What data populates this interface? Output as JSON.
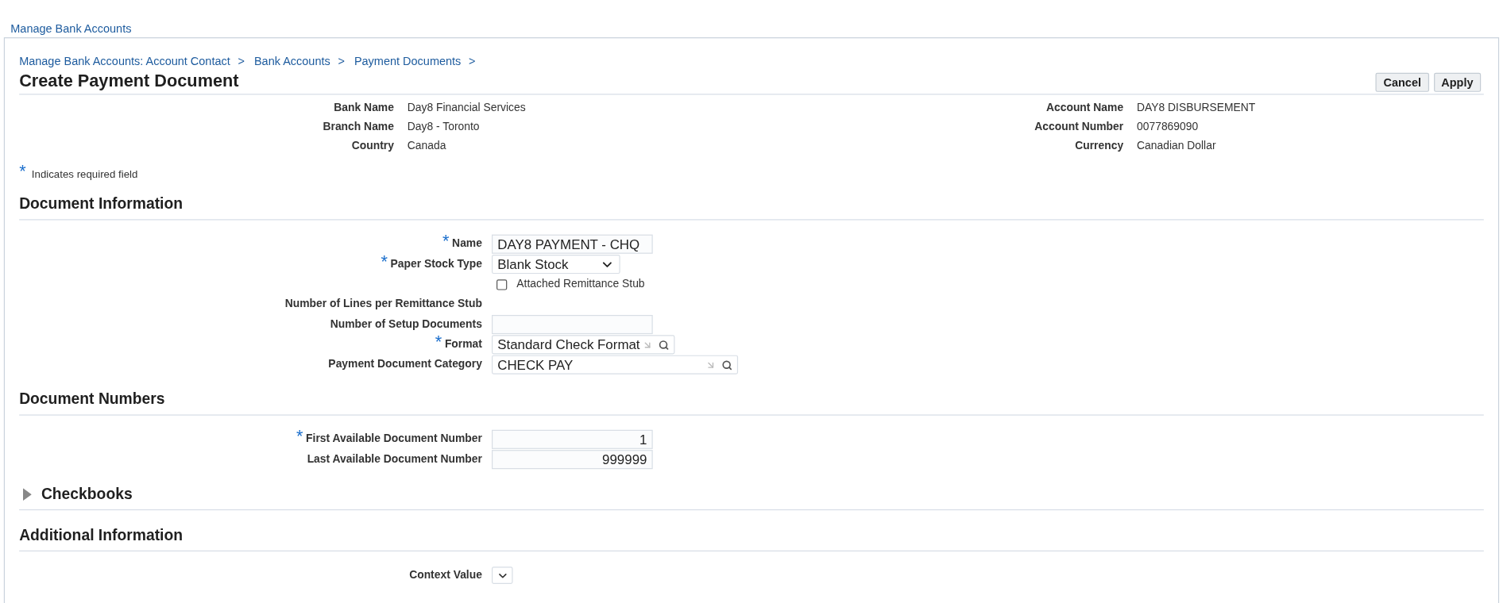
{
  "nav_link": "Manage Bank Accounts",
  "breadcrumbs": [
    {
      "label": "Manage Bank Accounts: Account Contact",
      "separator": ">"
    },
    {
      "label": "Bank Accounts",
      "separator": ">"
    },
    {
      "label": "Payment Documents",
      "separator": ">"
    }
  ],
  "title": "Create Payment Document",
  "buttons": [
    "Cancel",
    "Apply"
  ],
  "bank_info": {
    "left": [
      {
        "label": "Bank Name",
        "value": "Day8 Financial Services"
      },
      {
        "label": "Branch Name",
        "value": "Day8 - Toronto"
      },
      {
        "label": "Country",
        "value": "Canada"
      }
    ],
    "right": [
      {
        "label": "Account Name",
        "value": "DAY8 DISBURSEMENT"
      },
      {
        "label": "Account Number",
        "value": "0077869090"
      },
      {
        "label": "Currency",
        "value": "Canadian Dollar"
      }
    ]
  },
  "required_note": {
    "mark": "*",
    "text": "Indicates required field"
  },
  "sections": [
    {
      "title": "Document Information",
      "kind": "plain",
      "fields": [
        {
          "kind": "text",
          "label": "Name",
          "required_mark": "*",
          "value": "DAY8 PAYMENT - CHQ"
        },
        {
          "kind": "select",
          "label": "Paper Stock Type",
          "required_mark": "*",
          "value": "Blank Stock"
        },
        {
          "kind": "checkbox",
          "label": "Attached Remittance Stub",
          "checked": false
        },
        {
          "kind": "label",
          "label": "Number of Lines per Remittance Stub"
        },
        {
          "kind": "text",
          "label": "Number of Setup Documents"
        },
        {
          "kind": "lookup",
          "label": "Format",
          "required_mark": "*",
          "value": "Standard Check Format"
        },
        {
          "kind": "lookup",
          "label": "Payment Document Category",
          "value": "CHECK PAY"
        }
      ]
    },
    {
      "title": "Document Numbers",
      "kind": "plain",
      "fields": [
        {
          "kind": "number",
          "label": "First Available Document Number",
          "required_mark": "*",
          "value": "1"
        },
        {
          "kind": "number",
          "label": "Last Available Document Number",
          "value": "999999"
        }
      ]
    },
    {
      "title": "Checkbooks",
      "kind": "collapsible",
      "expanded": false
    },
    {
      "title": "Additional Information",
      "kind": "plain",
      "fields": [
        {
          "kind": "select",
          "label": "Context Value"
        }
      ]
    }
  ]
}
